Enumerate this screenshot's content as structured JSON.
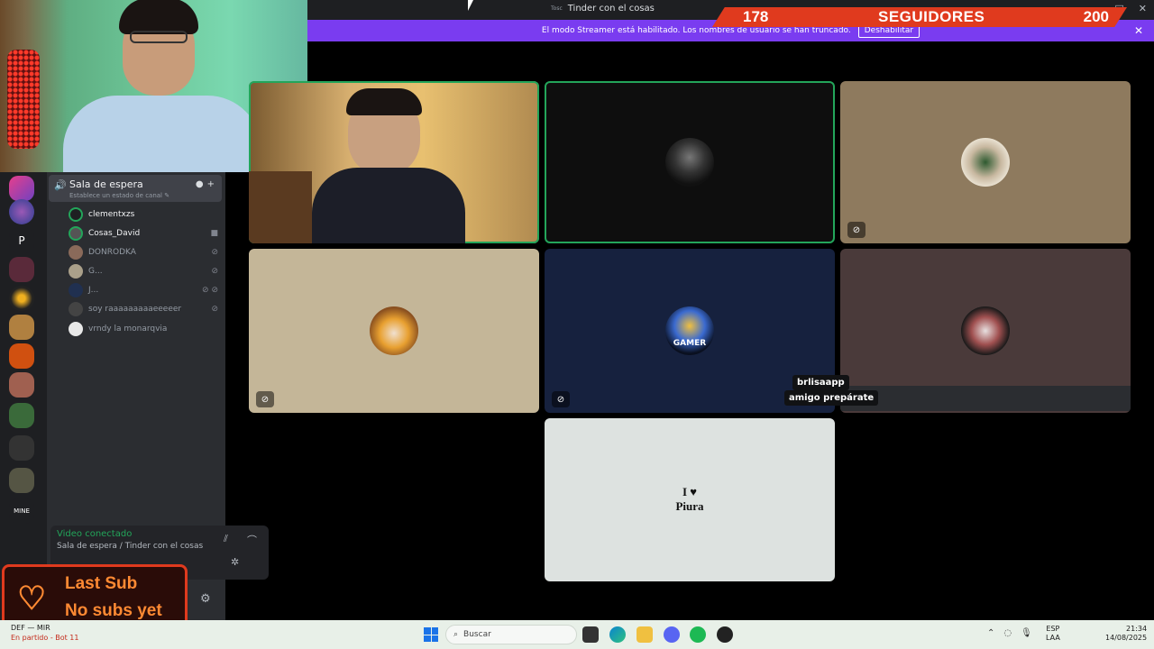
{
  "window": {
    "small_label": "Tosc",
    "title": "Tinder con el cosas",
    "controls": [
      "—",
      "□",
      "✕"
    ]
  },
  "followers": {
    "current": "178",
    "label": "SEGUIDORES",
    "goal": "200"
  },
  "banner": {
    "text": "El modo Streamer está habilitado. Los nombres de usuario se han truncado.",
    "button": "Deshabilitar",
    "close": "✕"
  },
  "sidebar": {
    "voice_channel": {
      "name": "Sala de espera",
      "status": "Establece un estado de canal ✎"
    },
    "members": [
      {
        "name": "clementxzs",
        "active": true,
        "icons": ""
      },
      {
        "name": "Cosas_David",
        "active": true,
        "icons": "■"
      },
      {
        "name": "DONRODKA",
        "active": false,
        "icons": "⊘"
      },
      {
        "name": "G...",
        "active": false,
        "icons": "⊘"
      },
      {
        "name": "J...",
        "active": false,
        "icons": "⊘ ⊘"
      },
      {
        "name": "soy raaaaaaaaaeeeeer",
        "active": false,
        "icons": "⊘"
      },
      {
        "name": "vrndy la monarqvia",
        "active": false,
        "icons": ""
      }
    ],
    "voice_panel": {
      "status": "Video conectado",
      "location": "Sala de espera / Tinder con el cosas"
    }
  },
  "last_sub": {
    "title": "Last Sub",
    "value": "No subs yet"
  },
  "servers": {
    "letter": "P",
    "mini_label": "MINE"
  },
  "grid": {
    "tile_avatar_8": {
      "line1": "I ♥",
      "line2": "Piura"
    },
    "captions": {
      "name": "brlisaapp",
      "message": "amigo prepárate"
    },
    "avatar_5_text": "GAMER"
  },
  "taskbar": {
    "game_line1": "DEF — MIR",
    "game_line2": "En partido - Bot 11",
    "search_placeholder": "Buscar",
    "lang_line1": "ESP",
    "lang_line2": "LAA",
    "time": "21:34",
    "date": "14/08/2025"
  },
  "colors": {
    "accent": "#7a3cf0",
    "speaking": "#23a55a",
    "overlay_orange": "#e03a1e",
    "sub_text": "#ff8a33"
  }
}
